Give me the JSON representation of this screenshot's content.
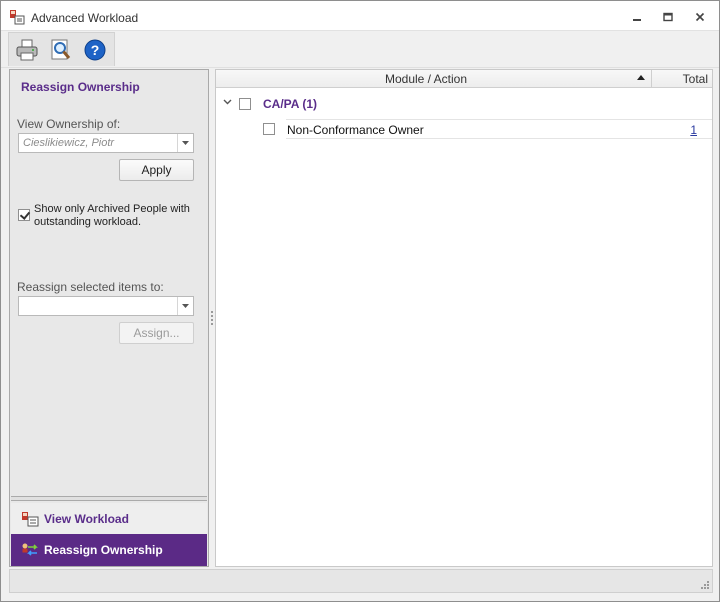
{
  "window": {
    "title": "Advanced Workload",
    "controls": [
      "minimize-icon",
      "restore-icon",
      "close-icon"
    ]
  },
  "toolbar": {
    "buttons": [
      {
        "name": "print",
        "icon": "printer-icon"
      },
      {
        "name": "preview",
        "icon": "magnifier-icon"
      },
      {
        "name": "help",
        "icon": "help-icon"
      }
    ]
  },
  "left_panel": {
    "title": "Reassign Ownership",
    "view_ownership_label": "View Ownership of:",
    "view_ownership_value": "Cieslikiewicz, Piotr",
    "apply_label": "Apply",
    "archived_checkbox_checked": true,
    "archived_checkbox_label": "Show only Archived People with outstanding workload.",
    "reassign_label": "Reassign selected items to:",
    "reassign_value": "",
    "assign_label": "Assign..."
  },
  "nav": {
    "items": [
      {
        "label": "View Workload",
        "icon": "workload-icon",
        "active": false
      },
      {
        "label": "Reassign Ownership",
        "icon": "reassign-arrows-icon",
        "active": true
      }
    ]
  },
  "grid": {
    "columns": [
      "Module / Action",
      "Total"
    ],
    "sort": "ascending",
    "groups": [
      {
        "label": "CA/PA (1)",
        "expanded": true,
        "checked": false,
        "rows": [
          {
            "action": "Non-Conformance Owner",
            "total": "1",
            "checked": false
          }
        ]
      }
    ]
  },
  "colors": {
    "accent": "#5b2a86",
    "accent_text": "#5a2d8a",
    "link": "#2a3aa0"
  }
}
